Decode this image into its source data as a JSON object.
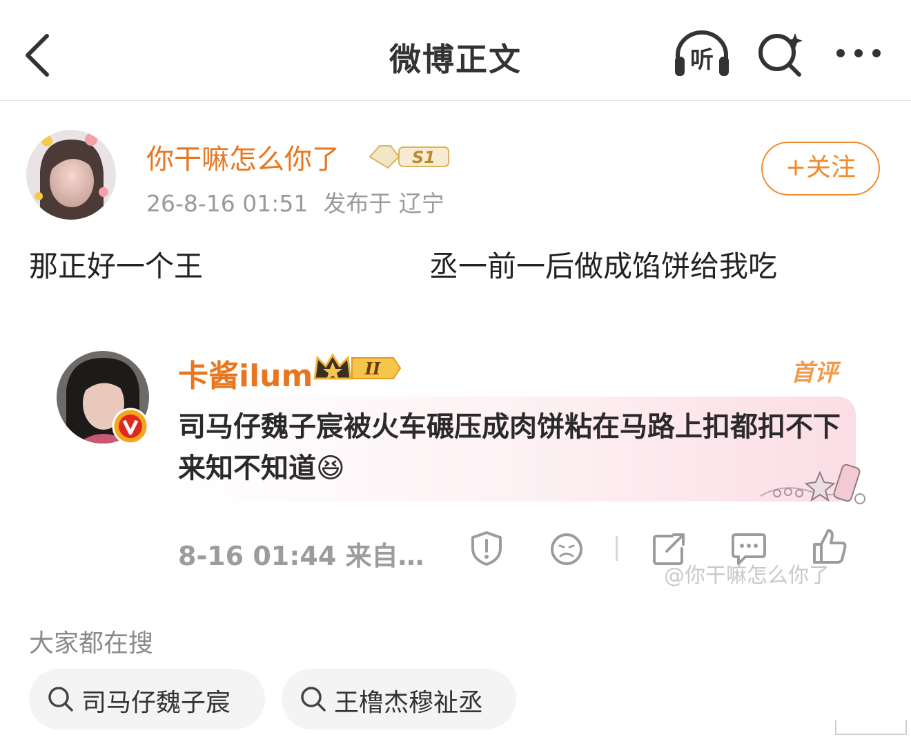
{
  "header": {
    "title": "微博正文",
    "listen_label": "听"
  },
  "post": {
    "author": "你干嘛怎么你了",
    "badge": "S1",
    "time": "26-8-16 01:51",
    "location": "发布于 辽宁",
    "follow_label": "+关注",
    "text_left": "那正好一个王",
    "text_right": "丞一前一后做成馅饼给我吃"
  },
  "comment": {
    "author": "卡酱ilum",
    "rank": "II",
    "first_label": "首评",
    "text": "司马仔魏子宸被火车碾压成肉饼粘在马路上扣都扣不下来知不知道",
    "emoji": "😆",
    "time": "8-16 01:44 来自…",
    "watermark": "@你干嘛怎么你了"
  },
  "hot_search": {
    "label": "大家都在搜",
    "items": [
      "司马仔魏子宸",
      "王橹杰穆祉丞"
    ]
  },
  "colors": {
    "accent": "#e8761f",
    "follow": "#f08a2c",
    "muted": "#9a9a9a"
  }
}
